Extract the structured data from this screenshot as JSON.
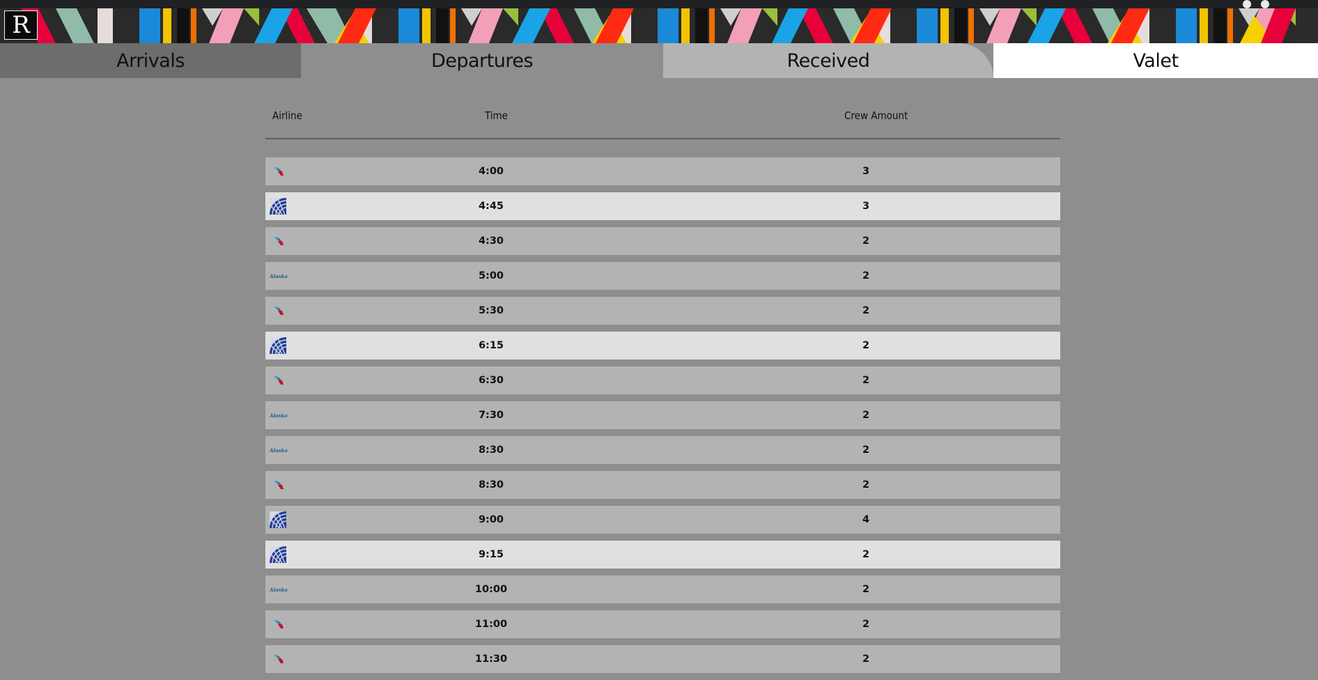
{
  "brand": {
    "logo_letter": "R"
  },
  "tabs": [
    {
      "label": "Arrivals",
      "active": false
    },
    {
      "label": "Departures",
      "active": true
    },
    {
      "label": "Received",
      "active": false
    },
    {
      "label": "Valet",
      "active": false
    }
  ],
  "table": {
    "headers": {
      "airline": "Airline",
      "time": "Time",
      "crew": "Crew Amount"
    },
    "rows": [
      {
        "airline": "american",
        "time": "4:00",
        "crew": "3",
        "highlight": false
      },
      {
        "airline": "united",
        "time": "4:45",
        "crew": "3",
        "highlight": true
      },
      {
        "airline": "american",
        "time": "4:30",
        "crew": "2",
        "highlight": false
      },
      {
        "airline": "alaska",
        "time": "5:00",
        "crew": "2",
        "highlight": false
      },
      {
        "airline": "american",
        "time": "5:30",
        "crew": "2",
        "highlight": false
      },
      {
        "airline": "united",
        "time": "6:15",
        "crew": "2",
        "highlight": true
      },
      {
        "airline": "american",
        "time": "6:30",
        "crew": "2",
        "highlight": false
      },
      {
        "airline": "alaska",
        "time": "7:30",
        "crew": "2",
        "highlight": false
      },
      {
        "airline": "alaska",
        "time": "8:30",
        "crew": "2",
        "highlight": false
      },
      {
        "airline": "american",
        "time": "8:30",
        "crew": "2",
        "highlight": false
      },
      {
        "airline": "united",
        "time": "9:00",
        "crew": "4",
        "highlight": false
      },
      {
        "airline": "united",
        "time": "9:15",
        "crew": "2",
        "highlight": true
      },
      {
        "airline": "alaska",
        "time": "10:00",
        "crew": "2",
        "highlight": false
      },
      {
        "airline": "american",
        "time": "11:00",
        "crew": "2",
        "highlight": false
      },
      {
        "airline": "american",
        "time": "11:30",
        "crew": "2",
        "highlight": false
      }
    ]
  },
  "colors": {
    "page_bg": "#8e8e8e",
    "row_bg": "#b3b3b3",
    "row_highlight_bg": "#e0e0e0",
    "tab_arrivals_bg": "#6d6d6d",
    "tab_received_bg": "#b3b3b3",
    "tab_valet_bg": "#ffffff"
  }
}
